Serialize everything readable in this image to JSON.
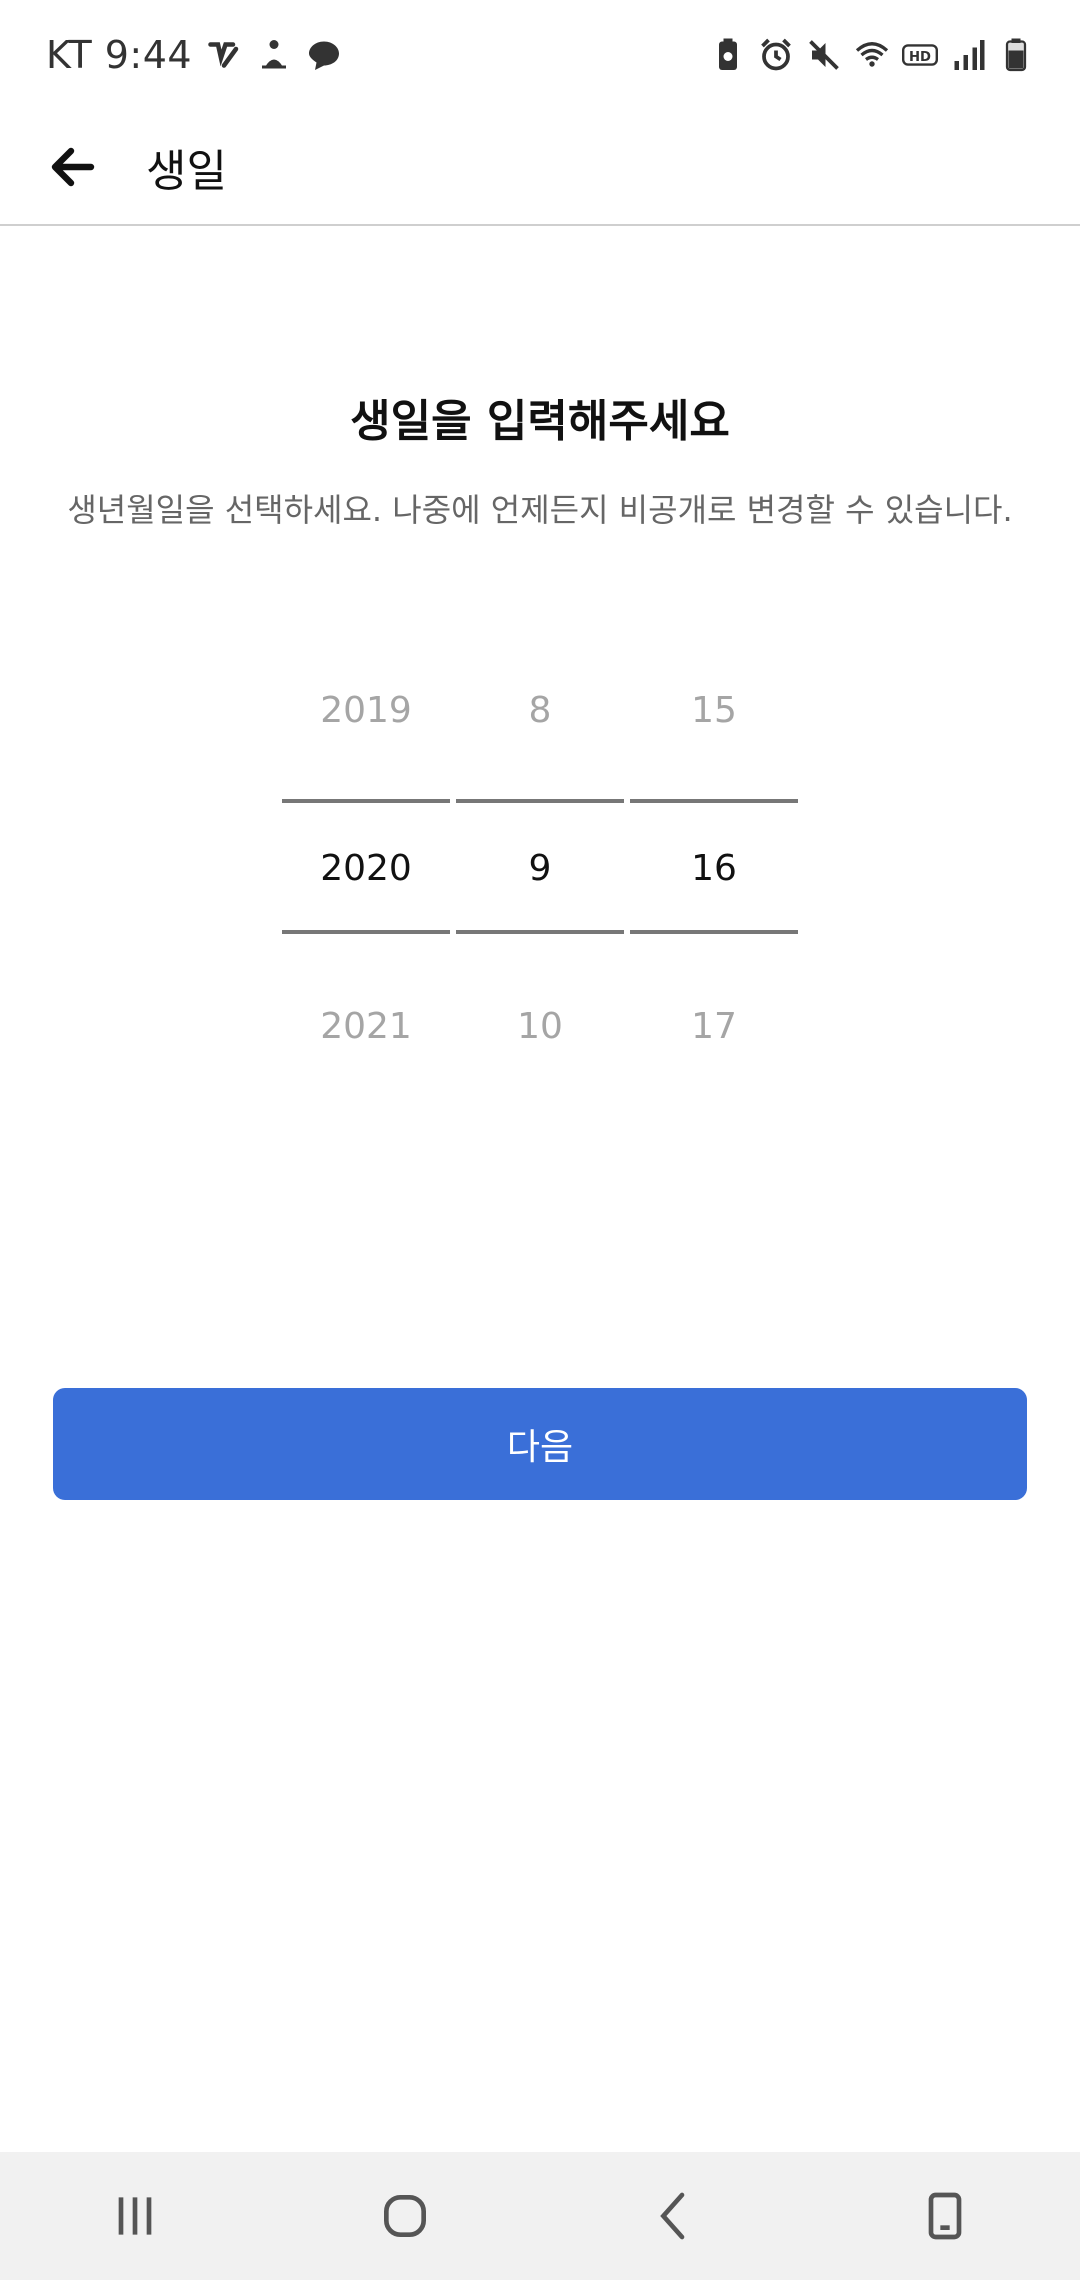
{
  "status_bar": {
    "carrier_time": "KT 9:44",
    "left_icons": [
      "vpn-key-icon",
      "person-meditating-icon",
      "chat-bubble-icon"
    ],
    "right_icons": [
      "battery-saver-icon",
      "alarm-icon",
      "mute-icon",
      "wifi-icon",
      "hd-icon",
      "signal-icon",
      "battery-icon"
    ]
  },
  "app_bar": {
    "title": "생일"
  },
  "content": {
    "heading": "생일을 입력해주세요",
    "subheading": "생년월일을 선택하세요. 나중에 언제든지 비공개로 변경할 수 있습니다."
  },
  "date_picker": {
    "year": {
      "prev": "2019",
      "selected": "2020",
      "next": "2021"
    },
    "month": {
      "prev": "8",
      "selected": "9",
      "next": "10"
    },
    "day": {
      "prev": "15",
      "selected": "16",
      "next": "17"
    }
  },
  "next_button": {
    "label": "다음"
  },
  "colors": {
    "accent": "#3a6fd8",
    "divider": "#777777",
    "muted_text": "#a5a5a5"
  }
}
